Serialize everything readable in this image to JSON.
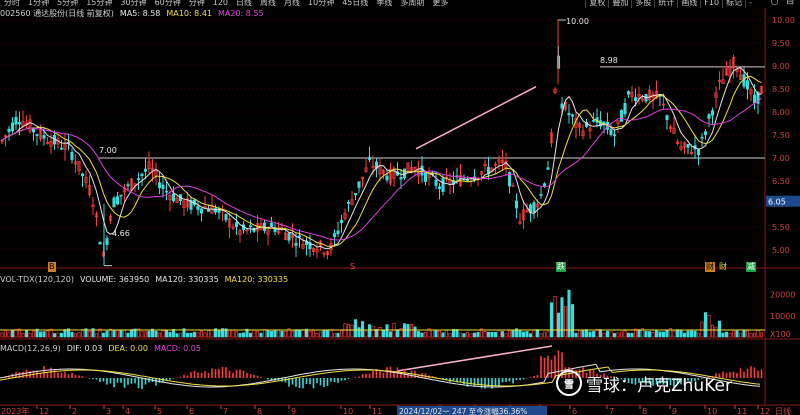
{
  "toolbar": {
    "tabs": [
      "分时",
      "1分钟",
      "5分钟",
      "15分钟",
      "30分钟",
      "60分钟",
      "分钟",
      "120",
      "日线",
      "周线",
      "月线",
      "10分钟",
      "45日线",
      "季线",
      "多周期",
      "更多"
    ],
    "right_buttons": [
      "复权",
      "叠加",
      "多股",
      "统计",
      "画线",
      "F10",
      "标记",
      "-"
    ],
    "window_controls": [
      "○",
      "⊟"
    ]
  },
  "stock": {
    "code": "002560 通达股份(日线 前复权)",
    "ma5": "MA5: 8.58",
    "ma10": "MA10: 8.41",
    "ma20": "MA20: 8.55"
  },
  "price_axis": [
    "10.00",
    "9.50",
    "9.00",
    "8.50",
    "8.00",
    "7.50",
    "7.00",
    "6.50",
    "6.00",
    "5.50",
    "5.00"
  ],
  "price_axis_highlight": "6.05",
  "annotations": {
    "high": "10.00",
    "resistance": "8.98",
    "support": "7.00",
    "low": "4.66"
  },
  "markers": {
    "m1": "B",
    "m2": "S",
    "m3": "跌",
    "m4": "财",
    "m5": "财",
    "m6": "减"
  },
  "volume": {
    "title": "VOL-TDX(120,120)",
    "volume": "VOLUME: 363950",
    "ma120a": "MA120: 330335",
    "ma120b": "MA120: 330335",
    "axis": [
      "20000",
      "10000",
      "X100"
    ]
  },
  "macd": {
    "title": "MACD(12,26,9)",
    "dif": "DIF: 0.03",
    "dea": "DEA: 0.00",
    "macd": "MACD: 0.05"
  },
  "date_axis": {
    "year_label": "2023年",
    "months": [
      "12",
      "2",
      "3",
      "4",
      "5",
      "6",
      "7",
      "8",
      "9",
      "10",
      "11",
      "12",
      "2",
      "3",
      "4",
      "5",
      "6",
      "7",
      "8",
      "9",
      "10",
      "11",
      "12"
    ],
    "highlight": "2024/12/02一 247 至今涨幅36.36%",
    "right_label": "日线"
  },
  "watermark": {
    "logo": "雪",
    "text": "雪球：卢克ZhuKer"
  },
  "colors": {
    "up": "#ff3a3a",
    "down": "#3adcdc",
    "ma5": "#e6e6e6",
    "ma10": "#f0e040",
    "ma20": "#e040e0",
    "trendline": "#ffb0c8"
  }
}
